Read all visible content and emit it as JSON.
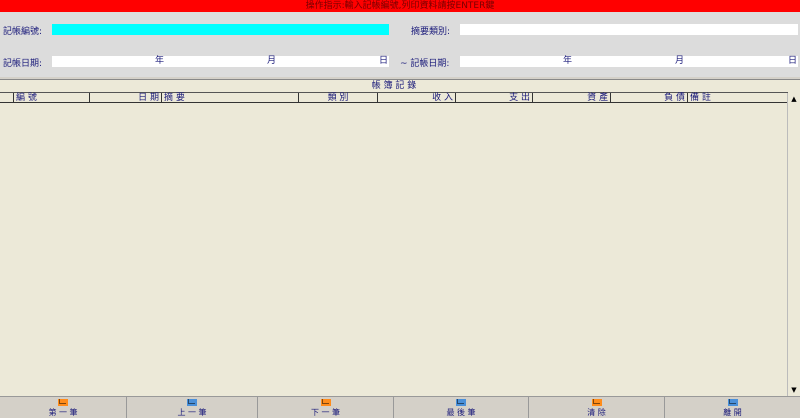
{
  "hint": "操作指示:輸入記帳編號,列印資料請按ENTER鍵",
  "form": {
    "record_no_label": "記帳編號:",
    "record_no_value": "",
    "summary_type_label": "摘要類別:",
    "summary_type_value": "",
    "date_from_label": "記帳日期:",
    "date_to_label": "~ 記帳日期:",
    "year": "年",
    "month": "月",
    "day": "日"
  },
  "grid": {
    "title": "帳 簿 記 錄",
    "columns": [
      "編 號",
      "日 期",
      "摘 要",
      "類 別",
      "收 入",
      "支 出",
      "資 產",
      "負 債",
      "備 註"
    ],
    "rows": []
  },
  "footer": {
    "buttons": [
      {
        "label": "第 一 筆",
        "icon": "envelope-icon",
        "color": "#ff8c1a"
      },
      {
        "label": "上 一 筆",
        "icon": "envelope-icon",
        "color": "#4a90d9"
      },
      {
        "label": "下 一 筆",
        "icon": "envelope-icon",
        "color": "#ff8c1a"
      },
      {
        "label": "最 後 筆",
        "icon": "envelope-icon",
        "color": "#4a90d9"
      },
      {
        "label": "清 除",
        "icon": "envelope-icon",
        "color": "#ff8c1a"
      },
      {
        "label": "離 開",
        "icon": "envelope-icon",
        "color": "#4a90d9"
      }
    ]
  },
  "colors": {
    "hint_bg": "#ff0000",
    "active_field": "#00ffff",
    "grid_bg": "#ece9d8"
  }
}
